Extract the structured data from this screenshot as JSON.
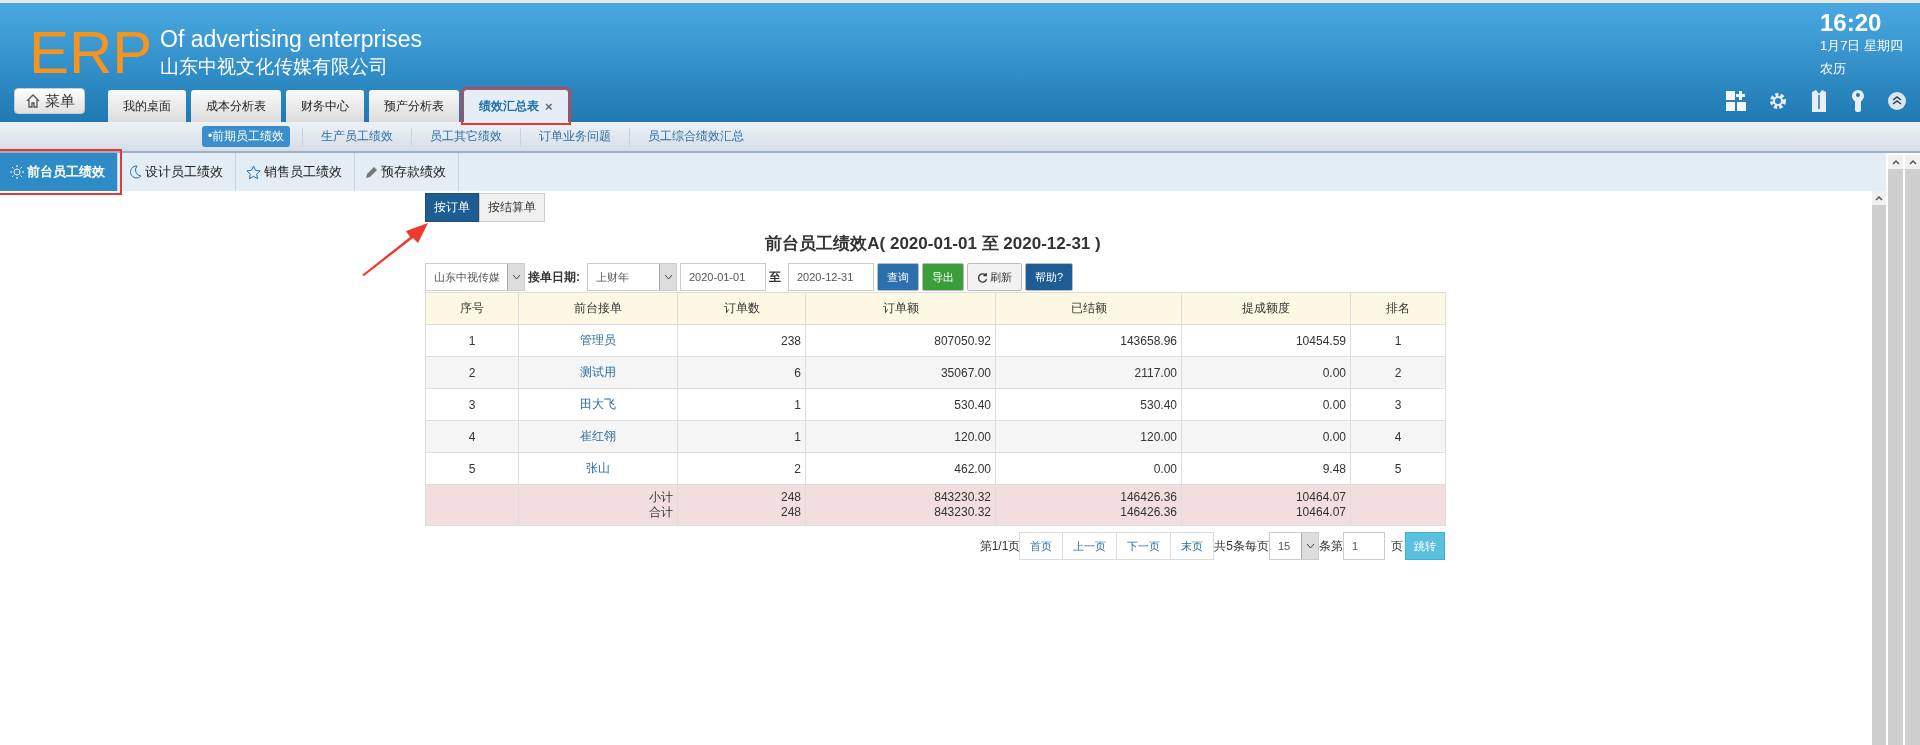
{
  "header": {
    "logo": "ERP",
    "tagline": "Of advertising enterprises",
    "company": "山东中视文化传媒有限公司",
    "menu_button": "菜单",
    "clock": {
      "time": "16:20",
      "date": "1月7日 星期四",
      "lunar": "农历"
    }
  },
  "window_tabs": [
    {
      "label": "我的桌面",
      "selected": false,
      "highlighted": false
    },
    {
      "label": "成本分析表",
      "selected": false,
      "highlighted": false
    },
    {
      "label": "财务中心",
      "selected": false,
      "highlighted": false
    },
    {
      "label": "预产分析表",
      "selected": false,
      "highlighted": false
    },
    {
      "label": "绩效汇总表",
      "selected": true,
      "highlighted": true,
      "close": "×"
    }
  ],
  "sub_nav": [
    {
      "label": "•前期员工绩效",
      "selected": true
    },
    {
      "label": "生产员工绩效",
      "selected": false
    },
    {
      "label": "员工其它绩效",
      "selected": false
    },
    {
      "label": "订单业务问题",
      "selected": false
    },
    {
      "label": "员工综合绩效汇总",
      "selected": false
    }
  ],
  "section_tabs": [
    {
      "label": "前台员工绩效",
      "selected": true,
      "highlighted": true
    },
    {
      "label": "设计员工绩效",
      "selected": false,
      "highlighted": false
    },
    {
      "label": "销售员工绩效",
      "selected": false,
      "highlighted": false
    },
    {
      "label": "预存款绩效",
      "selected": false,
      "highlighted": false
    }
  ],
  "view_toggle": [
    {
      "label": "按订单",
      "selected": true
    },
    {
      "label": "按结算单",
      "selected": false
    }
  ],
  "report": {
    "title": "前台员工绩效A( 2020-01-01 至 2020-12-31 )",
    "filters": {
      "company": "山东中视传媒",
      "date_label": "接单日期:",
      "period": "上财年",
      "from": "2020-01-01",
      "to_label": "至",
      "to": "2020-12-31",
      "buttons": [
        {
          "label": "查询",
          "kind": "primary"
        },
        {
          "label": "导出",
          "kind": "success"
        },
        {
          "label": "刷新",
          "kind": "refresh"
        },
        {
          "label": "帮助?",
          "kind": "info"
        }
      ]
    },
    "columns": [
      "序号",
      "前台接单",
      "订单数",
      "订单额",
      "已结额",
      "提成额度",
      "排名"
    ],
    "rows": [
      [
        "1",
        "管理员",
        "238",
        "807050.92",
        "143658.96",
        "10454.59",
        "1"
      ],
      [
        "2",
        "测试用",
        "6",
        "35067.00",
        "2117.00",
        "0.00",
        "2"
      ],
      [
        "3",
        "田大飞",
        "1",
        "530.40",
        "530.40",
        "0.00",
        "3"
      ],
      [
        "4",
        "崔红翎",
        "1",
        "120.00",
        "120.00",
        "0.00",
        "4"
      ],
      [
        "5",
        "张山",
        "2",
        "462.00",
        "0.00",
        "9.48",
        "5"
      ]
    ],
    "totals": [
      [
        "小计",
        "248",
        "843230.32",
        "146426.36",
        "10464.07"
      ],
      [
        "合计",
        "248",
        "843230.32",
        "146426.36",
        "10464.07"
      ]
    ],
    "pagination": {
      "page_info": "第1/1页",
      "links": [
        "首页",
        "上一页",
        "下一页",
        "末页"
      ],
      "count_label": "共5条每页",
      "page_size": "15",
      "goto_label": "条第",
      "page": "1",
      "page_unit": "页",
      "go": "跳转"
    }
  }
}
